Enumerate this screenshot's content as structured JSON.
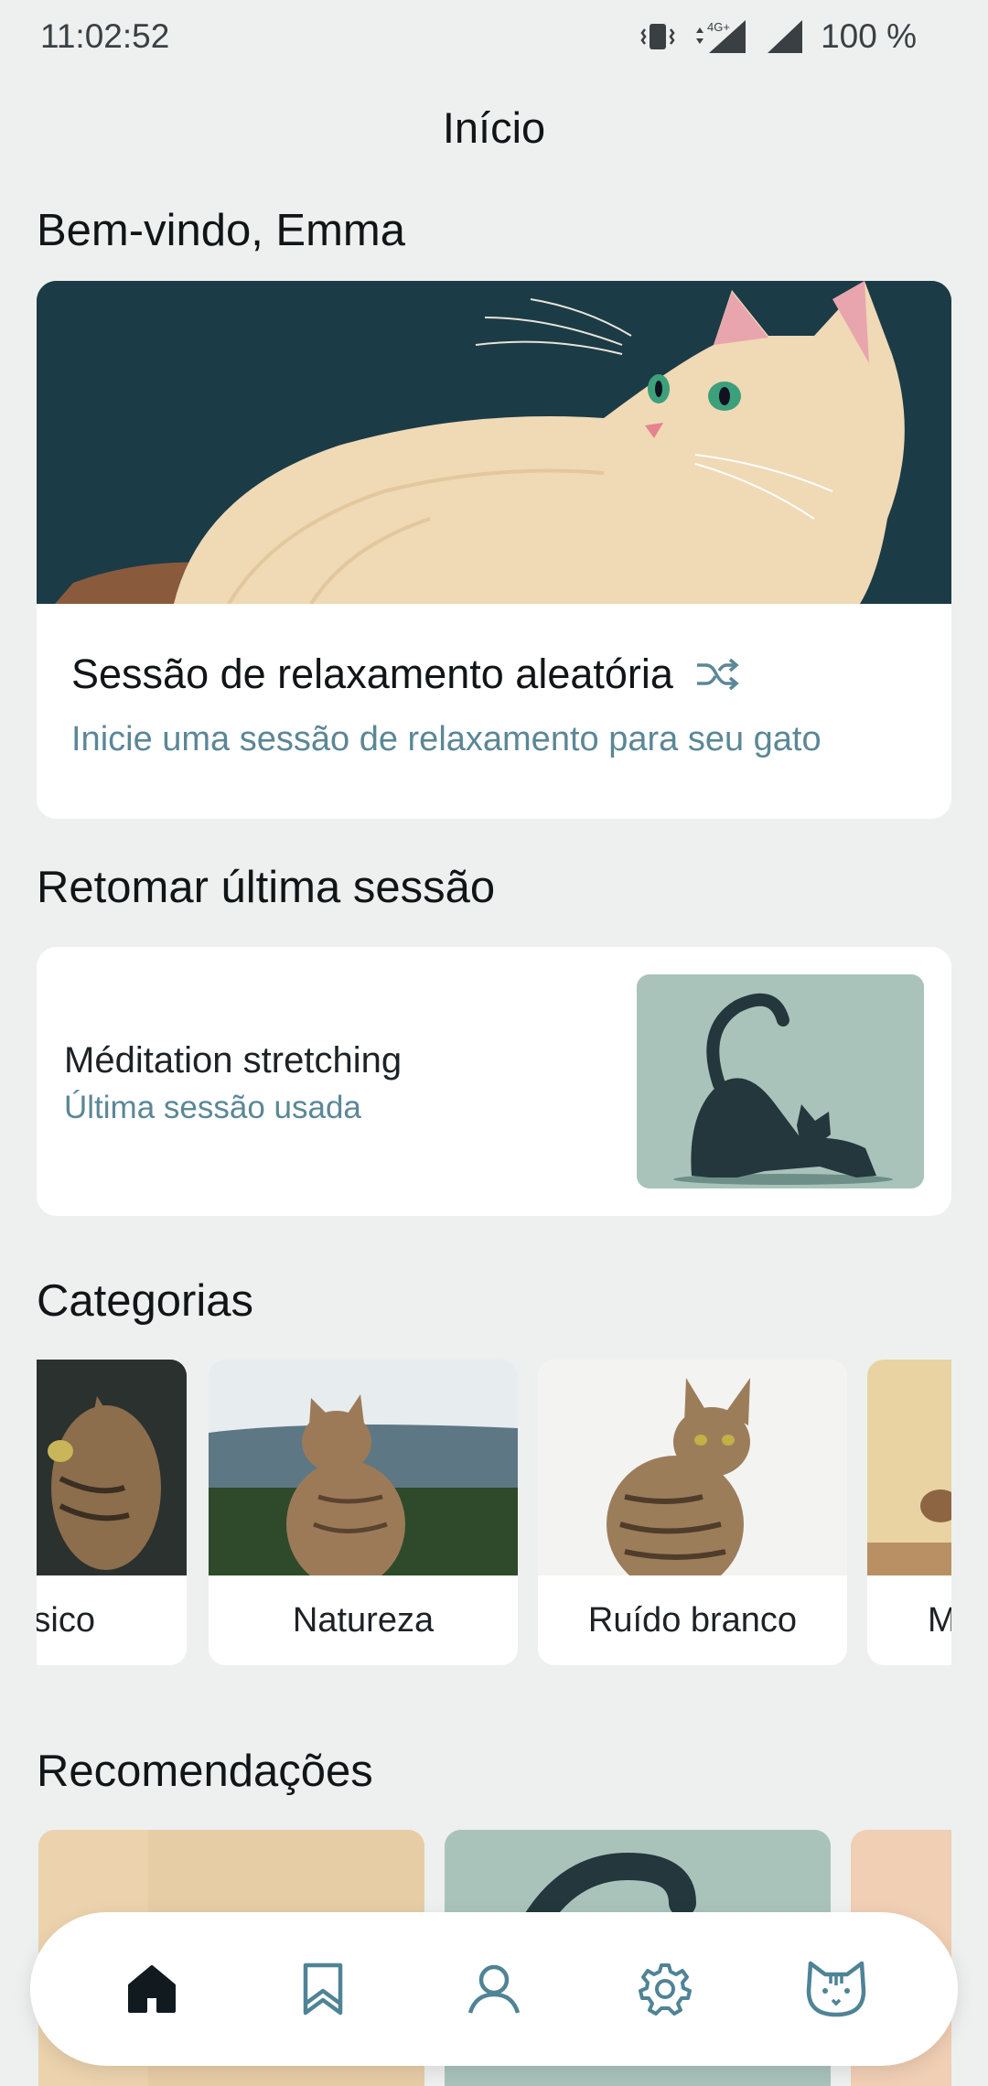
{
  "status": {
    "time": "11:02:52",
    "network": "4G+",
    "battery": "100 %",
    "icons": [
      "vibrate-icon",
      "data-arrows-icon",
      "signal-4g-icon",
      "signal-icon"
    ]
  },
  "header": {
    "title": "Início"
  },
  "welcome": {
    "title": "Bem-vindo, Emma"
  },
  "hero": {
    "title": "Sessão de relaxamento aleatória",
    "subtitle": "Inicie uma sessão de relaxamento para seu gato",
    "icon": "shuffle-icon"
  },
  "resume": {
    "section_title": "Retomar última sessão",
    "title": "Méditation stretching",
    "subtitle": "Última sessão usada"
  },
  "categories": {
    "section_title": "Categorias",
    "items": [
      {
        "label": "sico"
      },
      {
        "label": "Natureza"
      },
      {
        "label": "Ruído branco"
      },
      {
        "label": "M"
      }
    ]
  },
  "recommendations": {
    "section_title": "Recomendações"
  },
  "nav": {
    "items": [
      "home-icon",
      "bookmark-icon",
      "profile-icon",
      "settings-icon",
      "cat-icon"
    ],
    "active": "home-icon"
  },
  "colors": {
    "accent": "#5b8797",
    "dark": "#1b3b47",
    "background": "#edf0ef"
  }
}
